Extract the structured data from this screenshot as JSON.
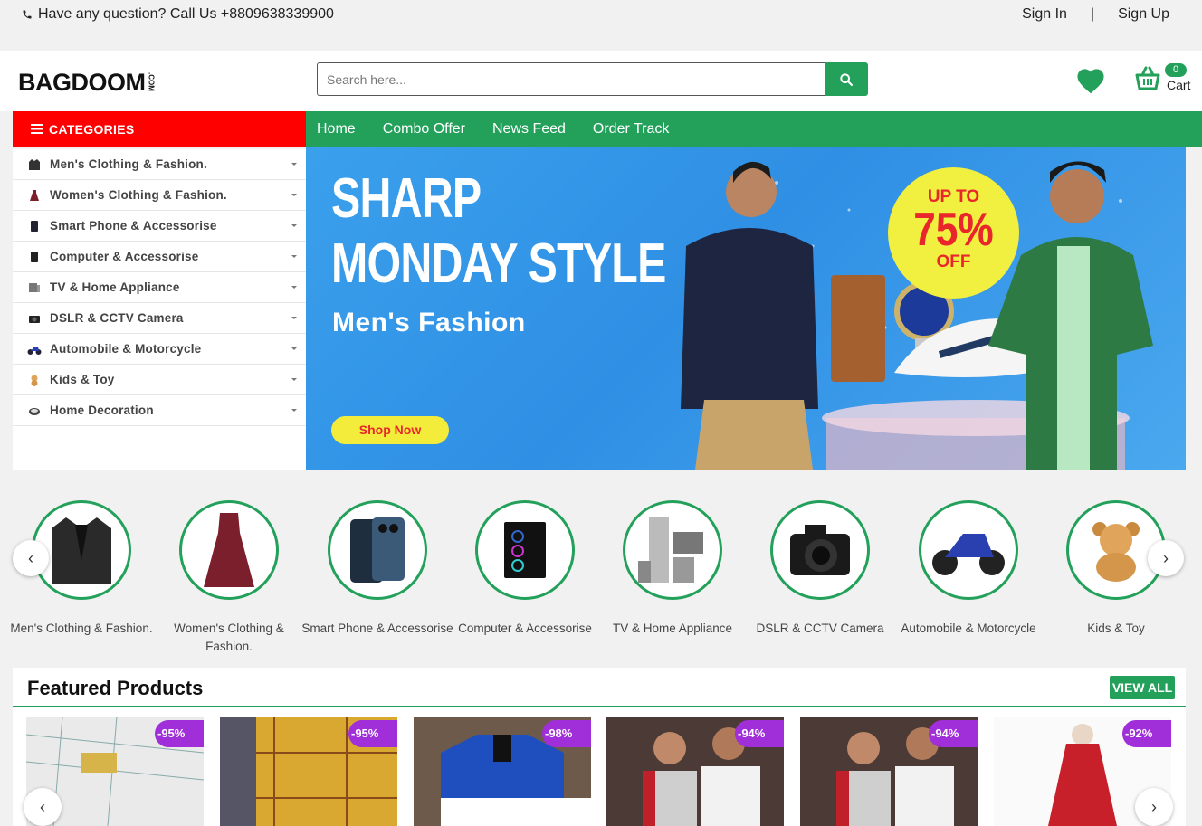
{
  "topbar": {
    "phone_text": "Have any question? Call Us +8809638339900",
    "sign_in": "Sign In",
    "separator": "|",
    "sign_up": "Sign Up"
  },
  "header": {
    "logo_text": "BAGDOOM",
    "logo_suffix": ".COM",
    "search_placeholder": "Search here...",
    "cart_count": "0",
    "cart_label": "Cart"
  },
  "colors": {
    "brand_green": "#23a15b",
    "categories_red": "#ff0000",
    "discount_purple": "#a02ed9",
    "banner_blue": "#3aa0ec",
    "promo_yellow": "#f1ef3f"
  },
  "nav": {
    "categories_label": "CATEGORIES",
    "links": [
      "Home",
      "Combo Offer",
      "News Feed",
      "Order Track"
    ]
  },
  "categories": [
    {
      "label": "Men's Clothing & Fashion.",
      "icon": "jacket-icon"
    },
    {
      "label": "Women's Clothing & Fashion.",
      "icon": "dress-icon"
    },
    {
      "label": "Smart Phone & Accessorise",
      "icon": "phone-icon"
    },
    {
      "label": "Computer & Accessorise",
      "icon": "computer-icon"
    },
    {
      "label": "TV & Home Appliance",
      "icon": "tv-icon"
    },
    {
      "label": "DSLR & CCTV Camera",
      "icon": "camera-icon"
    },
    {
      "label": "Automobile & Motorcycle",
      "icon": "motorcycle-icon"
    },
    {
      "label": "Kids & Toy",
      "icon": "teddy-icon"
    },
    {
      "label": "Home Decoration",
      "icon": "decor-icon"
    }
  ],
  "banner": {
    "headline_1": "SHARP",
    "headline_2": "MONDAY STYLE",
    "subhead": "Men's Fashion",
    "cta": "Shop Now",
    "promo_top": "UP TO",
    "promo_value": "75%",
    "promo_bottom": "OFF"
  },
  "category_circles": [
    {
      "label": "Men's Clothing & Fashion."
    },
    {
      "label": "Women's Clothing & Fashion."
    },
    {
      "label": "Smart Phone & Accessorise"
    },
    {
      "label": "Computer & Accessorise"
    },
    {
      "label": "TV & Home Appliance"
    },
    {
      "label": "DSLR & CCTV Camera"
    },
    {
      "label": "Automobile & Motorcycle"
    },
    {
      "label": "Kids & Toy"
    }
  ],
  "featured": {
    "title": "Featured Products",
    "view_all": "VIEW ALL",
    "products": [
      {
        "discount": "-95%"
      },
      {
        "discount": "-95%"
      },
      {
        "discount": "-98%"
      },
      {
        "discount": "-94%"
      },
      {
        "discount": "-94%"
      },
      {
        "discount": "-92%"
      }
    ]
  },
  "arrows": {
    "prev": "‹",
    "next": "›"
  }
}
